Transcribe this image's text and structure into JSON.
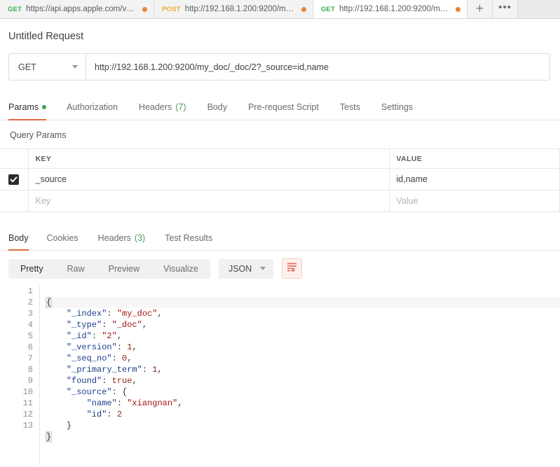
{
  "tabstrip": {
    "tabs": [
      {
        "method": "GET",
        "url": "https://api.apps.apple.com/v1/c…",
        "unsaved": true,
        "active": false
      },
      {
        "method": "POST",
        "url": "http://192.168.1.200:9200/my_…",
        "unsaved": true,
        "active": false
      },
      {
        "method": "GET",
        "url": "http://192.168.1.200:9200/my_…",
        "unsaved": true,
        "active": true
      }
    ],
    "new_tab_label": "+",
    "more_label": "•••"
  },
  "request": {
    "title": "Untitled Request",
    "method": "GET",
    "url": "http://192.168.1.200:9200/my_doc/_doc/2?_source=id,name",
    "tabs": [
      {
        "label": "Params",
        "badge": "",
        "dot": true,
        "active": true
      },
      {
        "label": "Authorization",
        "badge": "",
        "dot": false,
        "active": false
      },
      {
        "label": "Headers",
        "badge": "(7)",
        "dot": false,
        "active": false
      },
      {
        "label": "Body",
        "badge": "",
        "dot": false,
        "active": false
      },
      {
        "label": "Pre-request Script",
        "badge": "",
        "dot": false,
        "active": false
      },
      {
        "label": "Tests",
        "badge": "",
        "dot": false,
        "active": false
      },
      {
        "label": "Settings",
        "badge": "",
        "dot": false,
        "active": false
      }
    ]
  },
  "query_params": {
    "section_label": "Query Params",
    "columns": {
      "key": "KEY",
      "value": "VALUE"
    },
    "rows": [
      {
        "checked": true,
        "key": "_source",
        "value": "id,name",
        "placeholder": false
      },
      {
        "checked": false,
        "key": "Key",
        "value": "Value",
        "placeholder": true
      }
    ]
  },
  "response": {
    "tabs": [
      {
        "label": "Body",
        "badge": "",
        "active": true
      },
      {
        "label": "Cookies",
        "badge": "",
        "active": false
      },
      {
        "label": "Headers",
        "badge": "(3)",
        "active": false
      },
      {
        "label": "Test Results",
        "badge": "",
        "active": false
      }
    ],
    "view_modes": [
      {
        "label": "Pretty",
        "active": true
      },
      {
        "label": "Raw",
        "active": false
      },
      {
        "label": "Preview",
        "active": false
      },
      {
        "label": "Visualize",
        "active": false
      }
    ],
    "format": "JSON",
    "wrap_icon": "word-wrap-icon",
    "body": {
      "_index": "my_doc",
      "_type": "_doc",
      "_id": "2",
      "_version": 1,
      "_seq_no": 0,
      "_primary_term": 1,
      "found": true,
      "_source": {
        "name": "xiangnan",
        "id": 2
      }
    },
    "line_numbers": [
      "1",
      "2",
      "3",
      "4",
      "5",
      "6",
      "7",
      "8",
      "9",
      "10",
      "11",
      "12",
      "13"
    ],
    "code_lines": [
      "{",
      "    \"_index\": \"my_doc\",",
      "    \"_type\": \"_doc\",",
      "    \"_id\": \"2\",",
      "    \"_version\": 1,",
      "    \"_seq_no\": 0,",
      "    \"_primary_term\": 1,",
      "    \"found\": true,",
      "    \"_source\": {",
      "        \"name\": \"xiangnan\",",
      "        \"id\": 2",
      "    }",
      "}"
    ]
  },
  "colors": {
    "accent": "#e2683c",
    "get_method": "#3bab4a",
    "post_method": "#ebac2e",
    "unsaved_dot": "#e8833a",
    "params_dot": "#36a64f",
    "json_key": "#1b3e8c",
    "json_string": "#a31515",
    "json_number": "#8a2b1e"
  }
}
